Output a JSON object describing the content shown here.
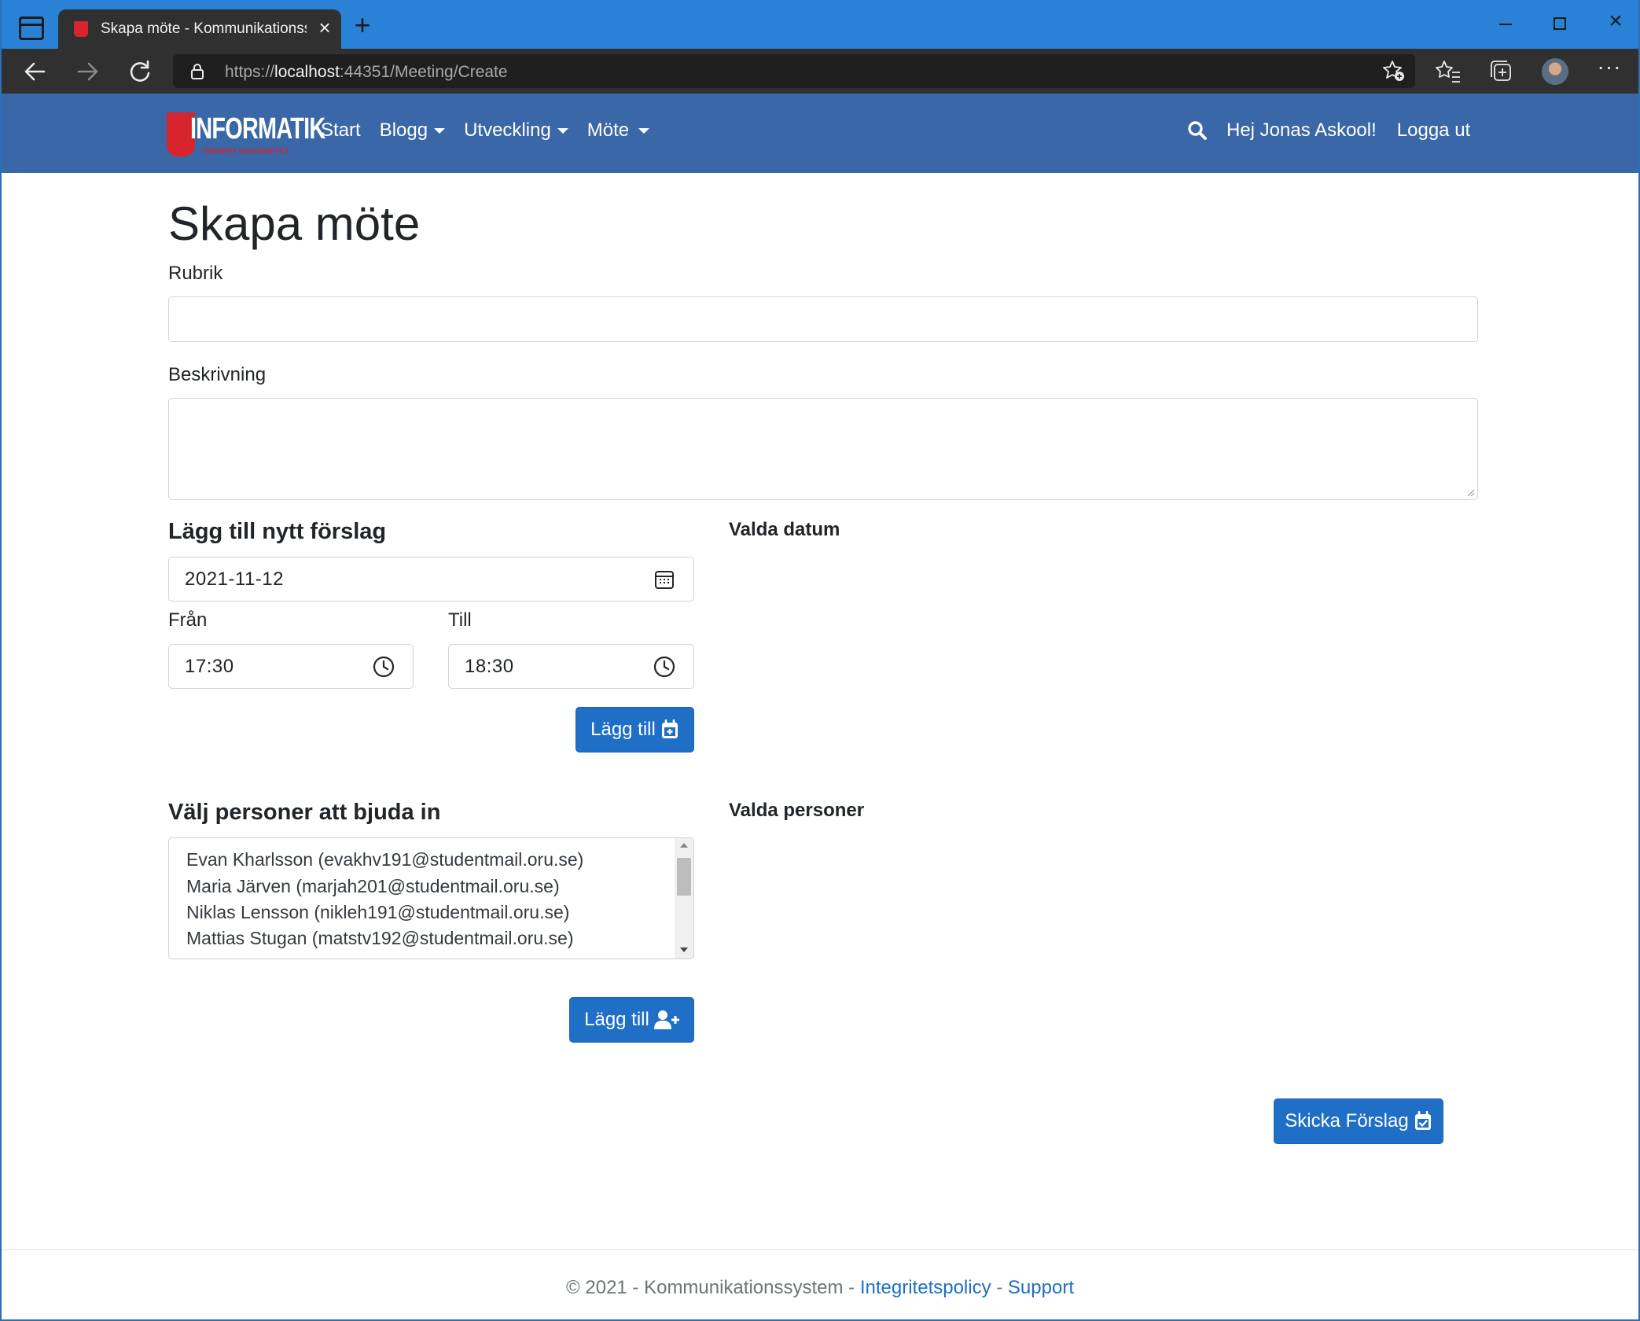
{
  "browser": {
    "tab_title": "Skapa möte - Kommunikationssystem",
    "url_scheme": "https://",
    "url_host": "localhost",
    "url_rest": ":44351/Meeting/Create"
  },
  "navbar": {
    "logo_text": "INFORMATIK",
    "logo_subtext": "ÖREBRO UNIVERSITET",
    "links": [
      {
        "label": "Start"
      },
      {
        "label": "Blogg"
      },
      {
        "label": "Utveckling"
      },
      {
        "label": "Möte"
      }
    ],
    "greeting": "Hej Jonas Askool!",
    "logout": "Logga ut"
  },
  "page": {
    "title": "Skapa möte",
    "rubrik_label": "Rubrik",
    "rubrik_value": "",
    "beskrivning_label": "Beskrivning",
    "beskrivning_value": "",
    "new_proposal_heading": "Lägg till nytt förslag",
    "date_value": "2021-11-12",
    "from_label": "Från",
    "from_value": "17:30",
    "to_label": "Till",
    "to_value": "18:30",
    "add_date_button": "Lägg till",
    "selected_dates_heading": "Valda datum",
    "invite_heading": "Välj personer att bjuda in",
    "people": [
      "Evan Kharlsson (evakhv191@studentmail.oru.se)",
      "Maria Järven (marjah201@studentmail.oru.se)",
      "Niklas Lensson (nikleh191@studentmail.oru.se)",
      "Mattias Stugan (matstv192@studentmail.oru.se)"
    ],
    "add_person_button": "Lägg till",
    "selected_people_heading": "Valda personer",
    "submit_button": "Skicka Förslag"
  },
  "footer": {
    "text": "© 2021 - Kommunikationssystem - ",
    "privacy": "Integritetspolicy",
    "separator": " - ",
    "support": "Support"
  },
  "colors": {
    "browser_accent": "#2a82d6",
    "navbar_bg": "#3a67a7",
    "primary_button": "#1e6fc5",
    "logo_red": "#d6252c"
  }
}
